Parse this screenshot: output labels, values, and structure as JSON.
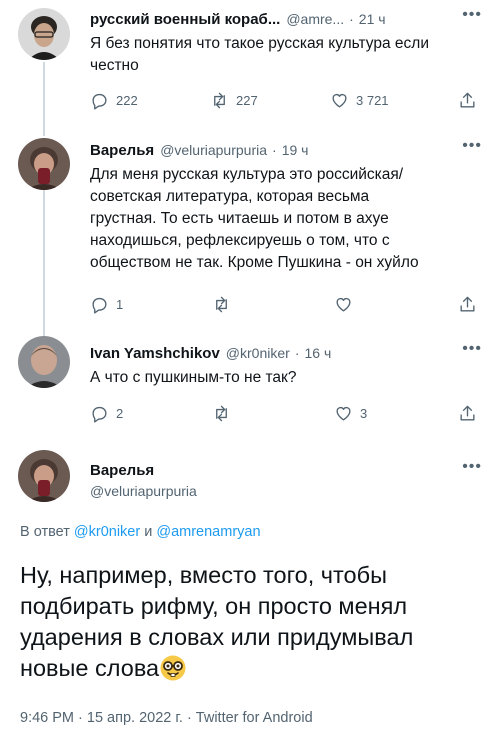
{
  "tweets": [
    {
      "name": "русский военный кораб...",
      "handle": "@amre...",
      "time": "21 ч",
      "text": "Я без понятия что такое русская культура если честно",
      "replies": "222",
      "retweets": "227",
      "likes": "3 721"
    },
    {
      "name": "Варелья",
      "handle": "@veluriapurpuria",
      "time": "19 ч",
      "text": "Для меня русская культура это российская/\nсоветская литература, которая весьма\nгрустная. То есть читаешь и потом в ахуе\nнаходишься, рефлексируешь о том, что с\nобществом не так. Кроме Пушкина - он хуйло",
      "replies": "1",
      "retweets": "",
      "likes": ""
    },
    {
      "name": "Ivan Yamshchikov",
      "handle": "@kr0niker",
      "time": "16 ч",
      "text": "А что с пушкиным-то не так?",
      "replies": "2",
      "retweets": "",
      "likes": "3"
    }
  ],
  "main_tweet": {
    "name": "Варелья",
    "handle": "@veluriapurpuria",
    "reply_prefix": "В ответ ",
    "reply_user1": "@kr0niker",
    "reply_and": " и ",
    "reply_user2": "@amrenamryan",
    "text": "Ну, например, вместо того, чтобы подбирать рифму, он просто менял ударения в словах или придумывал новые слова",
    "emoji": "nerd-face-emoji",
    "meta": "9:46 PM · 15 апр. 2022 г. · Twitter for Android"
  },
  "icons": [
    "reply-icon",
    "retweet-icon",
    "like-icon",
    "share-icon",
    "more-icon"
  ],
  "colors": {
    "text": "#0f1419",
    "secondary": "#536471",
    "link": "#1d9bf0",
    "thread_line": "#cfd9de"
  }
}
